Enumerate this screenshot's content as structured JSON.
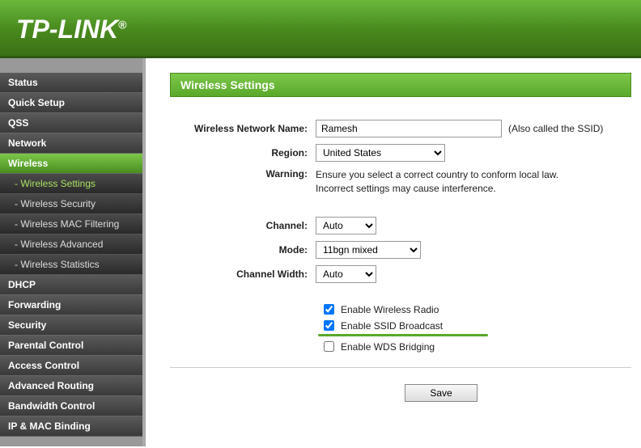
{
  "brand": "TP-LINK",
  "sidebar": {
    "items": [
      {
        "label": "Status",
        "active": false
      },
      {
        "label": "Quick Setup",
        "active": false
      },
      {
        "label": "QSS",
        "active": false
      },
      {
        "label": "Network",
        "active": false
      },
      {
        "label": "Wireless",
        "active": true,
        "subs": [
          {
            "label": "- Wireless Settings",
            "active": true
          },
          {
            "label": "- Wireless Security",
            "active": false
          },
          {
            "label": "- Wireless MAC Filtering",
            "active": false
          },
          {
            "label": "- Wireless Advanced",
            "active": false
          },
          {
            "label": "- Wireless Statistics",
            "active": false
          }
        ]
      },
      {
        "label": "DHCP",
        "active": false
      },
      {
        "label": "Forwarding",
        "active": false
      },
      {
        "label": "Security",
        "active": false
      },
      {
        "label": "Parental Control",
        "active": false
      },
      {
        "label": "Access Control",
        "active": false
      },
      {
        "label": "Advanced Routing",
        "active": false
      },
      {
        "label": "Bandwidth Control",
        "active": false
      },
      {
        "label": "IP & MAC Binding",
        "active": false
      }
    ]
  },
  "page": {
    "title": "Wireless Settings",
    "fields": {
      "network_name_label": "Wireless Network Name:",
      "network_name_value": "Ramesh",
      "network_name_hint": "(Also called the SSID)",
      "region_label": "Region:",
      "region_value": "United States",
      "warning_label": "Warning:",
      "warning_text1": "Ensure you select a correct country to conform local law.",
      "warning_text2": "Incorrect settings may cause interference.",
      "channel_label": "Channel:",
      "channel_value": "Auto",
      "mode_label": "Mode:",
      "mode_value": "11bgn mixed",
      "channel_width_label": "Channel Width:",
      "channel_width_value": "Auto",
      "enable_radio_label": "Enable Wireless Radio",
      "enable_radio_checked": true,
      "enable_ssid_label": "Enable SSID Broadcast",
      "enable_ssid_checked": true,
      "enable_wds_label": "Enable WDS Bridging",
      "enable_wds_checked": false,
      "save_label": "Save"
    }
  }
}
